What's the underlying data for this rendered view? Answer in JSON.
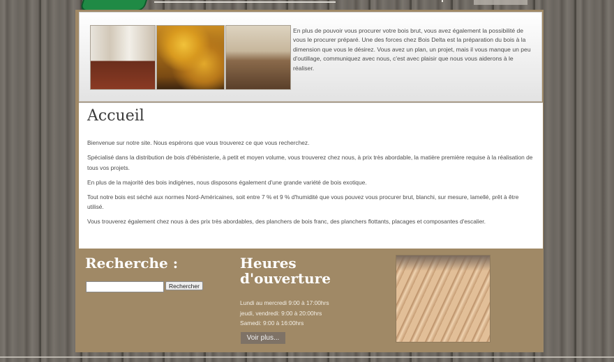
{
  "hero": {
    "description": "En plus de pouvoir vous procurer votre bois brut, vous avez également la possibilité de vous le procurer préparé. Une des forces chez Bois Delta est la préparation du bois à la dimension que vous le désirez. Vous avez un plan, un projet, mais il vous manque un peu d'outillage, communiquez avec nous, c'est avec plaisir que nous vous aiderons à le réaliser."
  },
  "main": {
    "title": "Accueil",
    "paragraphs": [
      "Bienvenue sur notre site. Nous espérons que vous trouverez ce que vous recherchez.",
      "Spécialisé dans la distribution de bois d'ébénisterie, à petit et moyen volume, vous trouverez chez nous, à prix très abordable, la matière première requise à la réalisation de tous vos projets.",
      "En plus de la majorité des bois  indigènes, nous disposons également d'une grande variété de bois exotique.",
      "Tout notre bois est séché aux normes Nord-Américaines, soit entre 7 % et 9 % d'humidité que vous pouvez vous procurer brut, blanchi, sur mesure, lamellé, prêt à être utilisé.",
      "Vous trouverez également chez nous à des prix très abordables, des planchers de bois franc, des planchers flottants, placages et composantes d'escalier."
    ]
  },
  "footer": {
    "search_title": "Recherche :",
    "search_value": "",
    "search_button": "Rechercher",
    "hours_title": "Heures d'ouverture",
    "hours": [
      "Lundi au mercredi 9:00 à 17:00hrs",
      "jeudi, vendredi: 9:00 à 20:00hrs",
      "Samedi: 9:00 à 16:00hrs"
    ],
    "more_button": "Voir plus..."
  },
  "colors": {
    "container_brown": "#a08966",
    "logo_green": "#1f8a45"
  }
}
